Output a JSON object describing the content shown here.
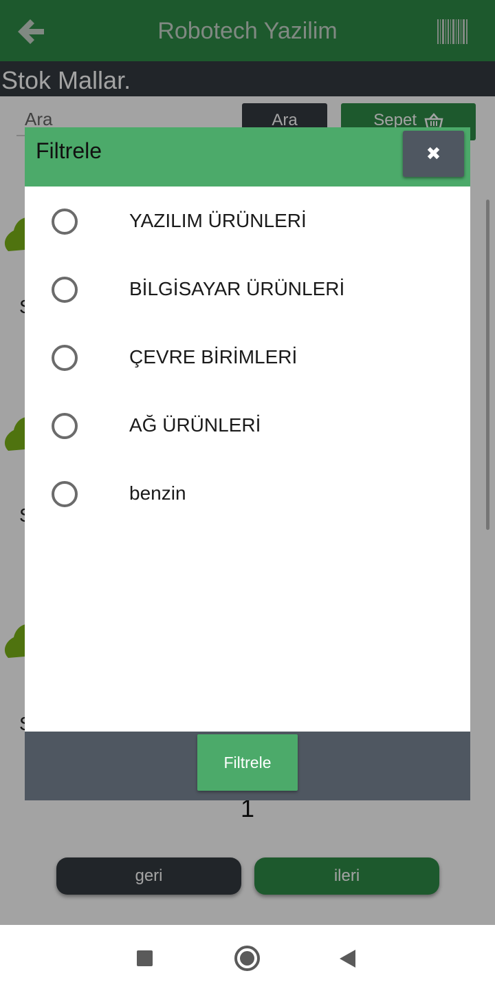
{
  "app": {
    "title": "Robotech Yazilim",
    "section_title": "Stok Mallar.",
    "search": {
      "placeholder": "Ara",
      "button_label": "Ara"
    },
    "cart_button_label": "Sepet",
    "card_letters": [
      "S",
      "S",
      "S"
    ],
    "pagination": {
      "page": "1",
      "prev_label": "geri",
      "next_label": "ileri"
    }
  },
  "modal": {
    "title": "Filtrele",
    "close_icon": "close-icon",
    "options": [
      {
        "label": "YAZILIM ÜRÜNLERİ",
        "selected": false
      },
      {
        "label": "BİLGİSAYAR ÜRÜNLERİ",
        "selected": false
      },
      {
        "label": "ÇEVRE BİRİMLERİ",
        "selected": false
      },
      {
        "label": "AĞ ÜRÜNLERİ",
        "selected": false
      },
      {
        "label": "benzin",
        "selected": false
      }
    ],
    "submit_label": "Filtrele"
  },
  "colors": {
    "primary_green": "#2e8b47",
    "modal_header_green": "#4caa6a",
    "dark": "#343a40",
    "footer_gray": "#4f5761"
  }
}
